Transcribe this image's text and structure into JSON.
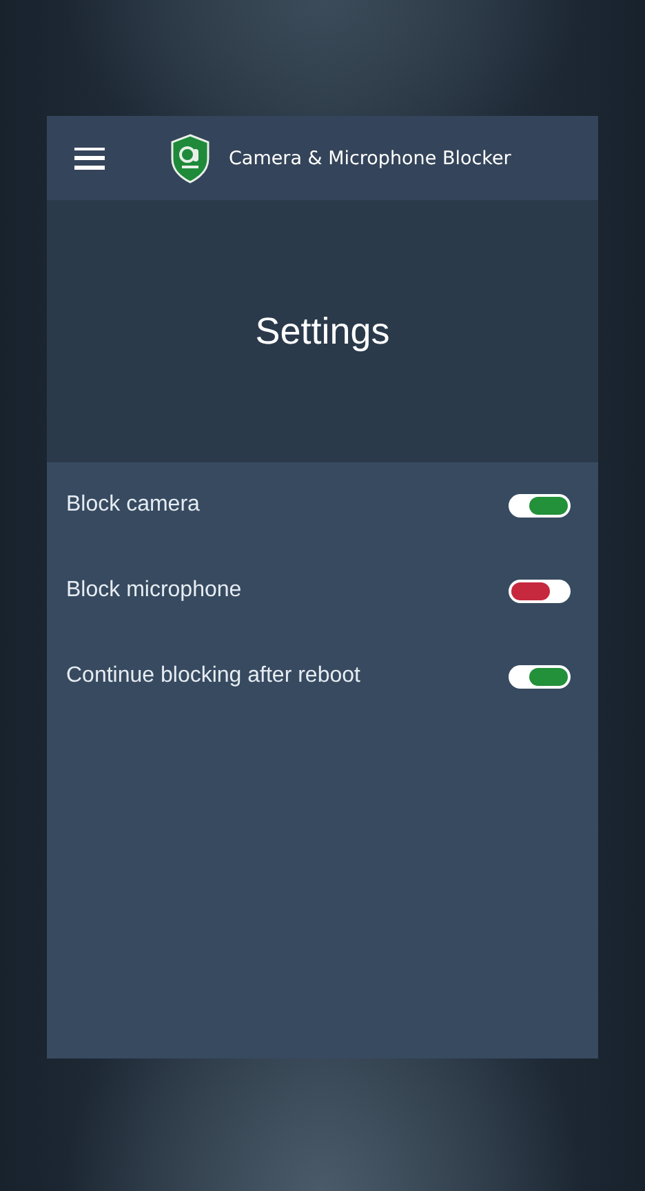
{
  "app_bar": {
    "title": "Camera & Microphone Blocker"
  },
  "hero": {
    "title": "Settings"
  },
  "settings": [
    {
      "label": "Block camera",
      "on": true
    },
    {
      "label": "Block microphone",
      "on": false
    },
    {
      "label": "Continue blocking after reboot",
      "on": true
    }
  ]
}
